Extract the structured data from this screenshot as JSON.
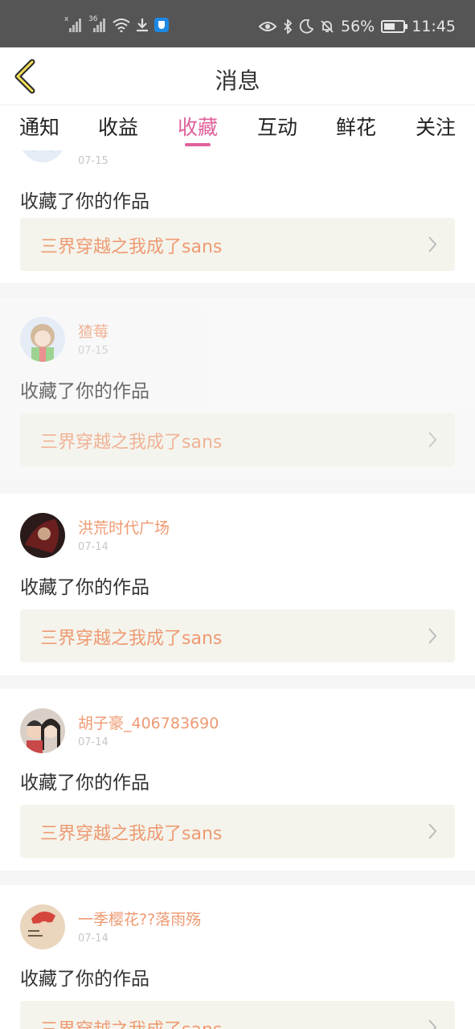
{
  "status_bar": {
    "signal1_tag": "x",
    "signal2_tag": "36",
    "battery": "56%",
    "time": "11:45"
  },
  "header": {
    "title": "消息"
  },
  "tabs": [
    {
      "label": "通知"
    },
    {
      "label": "收益"
    },
    {
      "label": "收藏"
    },
    {
      "label": "互动"
    },
    {
      "label": "鲜花"
    },
    {
      "label": "关注"
    }
  ],
  "active_tab": "收藏",
  "colors": {
    "accent": "#e0609a",
    "username": "#ee9a72",
    "work_bg": "#f4f4ec"
  },
  "feed": [
    {
      "user": "",
      "date": "07-15",
      "action": "收藏了你的作品",
      "work": "三界穿越之我成了sans"
    },
    {
      "user": "猹莓",
      "date": "07-15",
      "action": "收藏了你的作品",
      "work": "三界穿越之我成了sans"
    },
    {
      "user": "洪荒时代广场",
      "date": "07-14",
      "action": "收藏了你的作品",
      "work": "三界穿越之我成了sans"
    },
    {
      "user": "胡子豪_406783690",
      "date": "07-14",
      "action": "收藏了你的作品",
      "work": "三界穿越之我成了sans"
    },
    {
      "user": "一季樱花??落雨殇",
      "date": "07-14",
      "action": "收藏了你的作品",
      "work": "三界穿越之我成了sans"
    }
  ]
}
